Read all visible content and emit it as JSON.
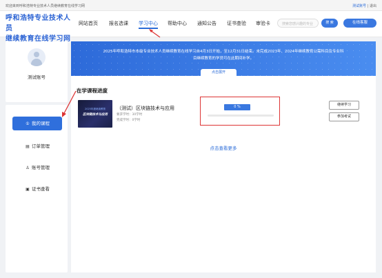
{
  "topbar": {
    "welcome": "欢迎来到呼和浩特专业技术人员继续教育在线学习网",
    "account": "测试账号",
    "separator": " | ",
    "logout": "退出"
  },
  "header": {
    "logo_line1": "呼和浩特专业技术人员",
    "logo_line2": "继续教育在线学习网",
    "nav": [
      "网站首页",
      "报名选课",
      "学习中心",
      "帮助中心",
      "通知公告",
      "证书查验",
      "审验卡"
    ],
    "active_nav_index": 2,
    "search_placeholder": "搜索您感兴趣的专业",
    "search_button": "搜 索",
    "consult_button": "在线客服"
  },
  "sidebar": {
    "username": "测试账号",
    "menu": [
      {
        "label": "我的课程",
        "icon": "book-icon",
        "glyph": "①",
        "active": true
      },
      {
        "label": "订单管理",
        "icon": "order-icon",
        "glyph": "▤",
        "active": false
      },
      {
        "label": "账号管理",
        "icon": "user-icon",
        "glyph": "♙",
        "active": false
      },
      {
        "label": "证书查看",
        "icon": "certificate-icon",
        "glyph": "▣",
        "active": false
      }
    ]
  },
  "banner": {
    "line1": "2025年呼和浩特市本级专业技术人员继续教育在线学习自4月3日开始，至12月31日结束。未完成2023年、2024年继续教育公需科目及专业科",
    "line2": "目继续教育的学员可在此期间补学。",
    "expand_label": "点击展开"
  },
  "main": {
    "section_title": "在学课程进度",
    "course": {
      "thumb_line1": "2025年度继续教育",
      "thumb_line2": "区块链技术与应用",
      "title": "（测试）区块链技术与应用",
      "required_hours": "要求学时：30学时",
      "completed_hours": "完成学时：0学时",
      "progress_label": "0 %",
      "progress_fraction": 0,
      "continue_button": "继续学习",
      "exam_button": "参加考试"
    },
    "more_link": "点击查看更多"
  },
  "colors": {
    "accent": "#2a6bd8",
    "annotation": "#dd3333"
  }
}
